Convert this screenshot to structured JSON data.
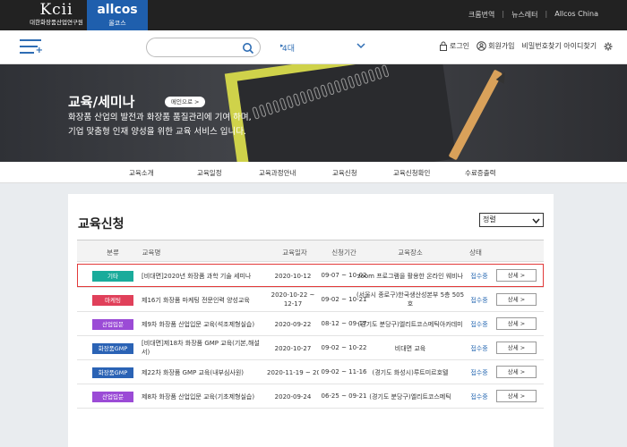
{
  "top": {
    "kcii_logo": "Kcii",
    "kcii_sub": "대한화장품산업연구원",
    "allcos_logo": "allcos",
    "allcos_sub": "올코스",
    "links": [
      "크롬번역",
      "뉴스레터",
      "Allcos China"
    ]
  },
  "header": {
    "search_placeholder": "",
    "category": "4대",
    "login": "로그인",
    "signup": "회원가입",
    "find": "비밀번호찾기 아이디찾기"
  },
  "banner": {
    "title": "교육/세미나",
    "main_button": "메인으로 >",
    "line1": "화장품 산업의 발전과 화장품 품질관리에 기여 하며,",
    "line2": "기업 맞춤형 인재 양성을 위한 교육 서비스 입니다."
  },
  "subnav": [
    "교육소개",
    "교육일정",
    "교육과정안내",
    "교육신청",
    "교육신청확인",
    "수료증출력"
  ],
  "main": {
    "page_title": "교육신청",
    "sort_value": "정렬",
    "headers": [
      "분류",
      "교육명",
      "교육일자",
      "신청기간",
      "교육장소",
      "상태"
    ],
    "rows": [
      {
        "category": "기타",
        "color": "#1aab9b",
        "name": "[비대면]2020년 화장품 과학 기술 세미나",
        "date": "2020-10-12",
        "period": "09-07 ~ 10-02",
        "place": "zoom 프로그램을 활용한 온라인 웨비나",
        "status": "접수중",
        "detail": "상세 >"
      },
      {
        "category": "마케팅",
        "color": "#e0405a",
        "name": "제16기 화장품 마케팅 전문인력 양성교육",
        "date": "2020-10-22 ~ 12-17",
        "period": "09-02 ~ 10-21",
        "place": "(서울시 종로구)한국생산성본부 5층 505호",
        "status": "접수중",
        "detail": "상세 >"
      },
      {
        "category": "산업입문",
        "color": "#9b4bd6",
        "name": "제9차 화장품 산업입문 교육(석조제형실습)",
        "date": "2020-09-22",
        "period": "08-12 ~ 09-17",
        "place": "(경기도 분당구)엘리트코스메틱아카데미",
        "status": "접수중",
        "detail": "상세 >"
      },
      {
        "category": "화장품GMP",
        "color": "#2b63b5",
        "name": "[비대면]제18차 화장품 GMP 교육(기본,해설서)",
        "date": "2020-10-27",
        "period": "09-02 ~ 10-22",
        "place": "비대면 교육",
        "status": "접수중",
        "detail": "상세 >"
      },
      {
        "category": "화장품GMP",
        "color": "#2b63b5",
        "name": "제22차 화장품 GMP 교육(내부심사원)",
        "date": "2020-11-19 ~ 20",
        "period": "09-02 ~ 11-16",
        "place": "(경기도 화성시)루트미르호텔",
        "status": "접수중",
        "detail": "상세 >"
      },
      {
        "category": "산업입문",
        "color": "#9b4bd6",
        "name": "제8차 화장품 산업입문 교육(기초제형실습)",
        "date": "2020-09-24",
        "period": "06-25 ~ 09-21",
        "place": "(경기도 분당구)엘리트코스메틱",
        "status": "접수중",
        "detail": "상세 >"
      }
    ]
  }
}
